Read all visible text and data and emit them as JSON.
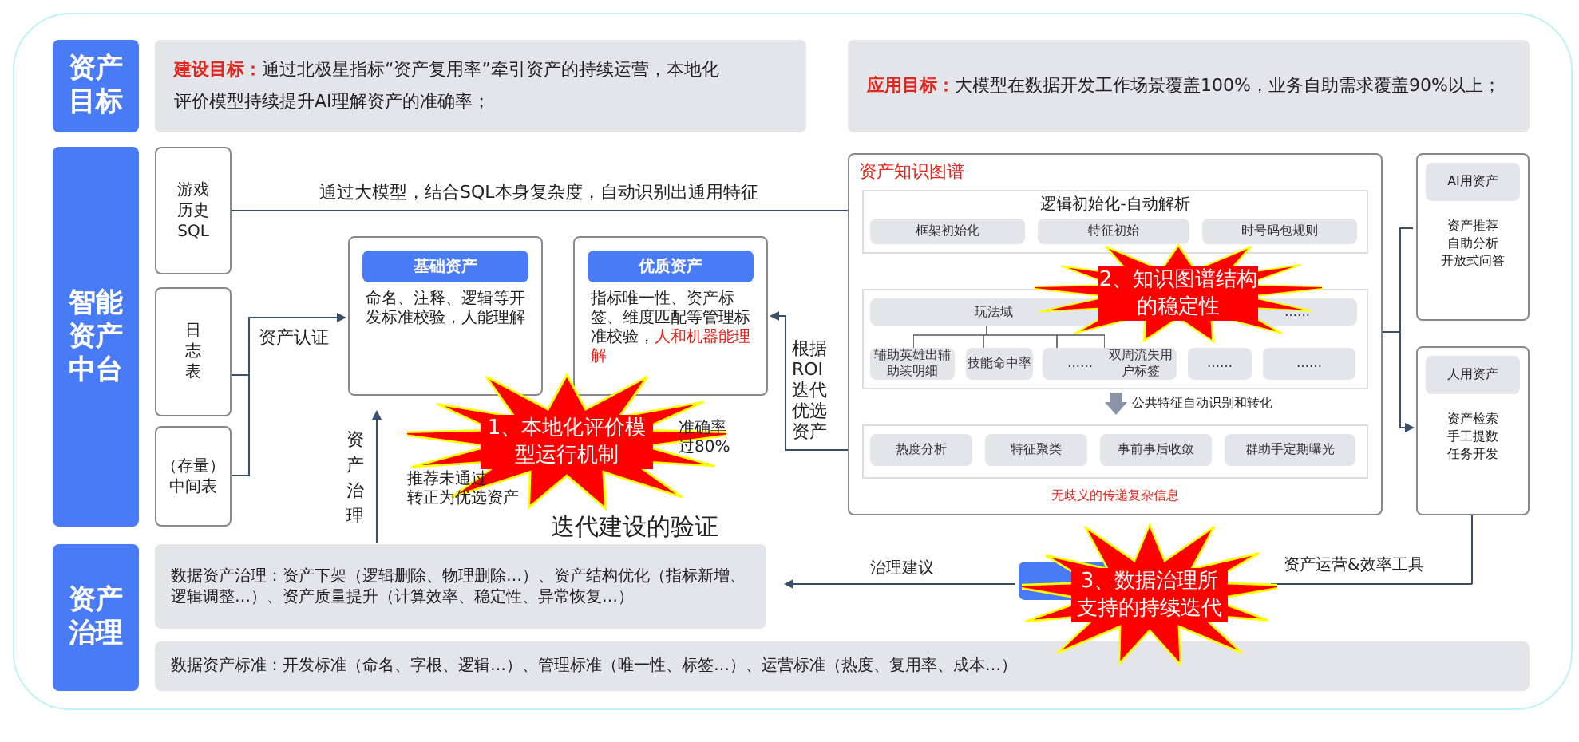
{
  "sections": [
    {
      "title": "资产目标"
    },
    {
      "title": "智能资产中台"
    },
    {
      "title": "资产治理"
    }
  ],
  "goals": [
    {
      "label": "建设目标：",
      "text": "通过北极星指标“资产复用率”牵引资产的持续运营，本地化评价模型持续提升AI理解资产的准确率；"
    },
    {
      "label": "应用目标：",
      "text": "大模型在数据开发工作场景覆盖100%，业务自助需求覆盖90%以上；"
    }
  ],
  "sources": [
    {
      "lines": [
        "游戏",
        "历史",
        "SQL"
      ]
    },
    {
      "lines": [
        "日",
        "志",
        "表"
      ]
    },
    {
      "lines": [
        "（存量）",
        "中间表"
      ]
    }
  ],
  "top_flow": "通过大模型，结合SQL本身复杂度，自动识别出通用特征",
  "certify": "资产认证",
  "asset_cards": [
    {
      "title": "基础资产",
      "text": "命名、注释、逻辑等开发标准校验，人能理解"
    },
    {
      "title": "优质资产",
      "text": "指标唯一性、资产标签、维度匹配等管理标准校验，",
      "highlight": "人和机器能理解"
    }
  ],
  "governance_up": "资产治理",
  "partial_texts": [
    "准确率",
    "过80%",
    "推荐未通过",
    "转正为优选资产"
  ],
  "roi_text": "根据ROI迭代优选资产",
  "validation": "迭代建设的验证",
  "knowledge_graph": {
    "title": "资产知识图谱",
    "init": {
      "title": "逻辑初始化-自动解析",
      "items": [
        "框架初始化",
        "特征初始",
        "时号码包规则"
      ]
    },
    "domains": {
      "headers": [
        "玩法域",
        "……"
      ],
      "items": [
        "辅助英雄出辅助装明细",
        "技能命中率",
        "……",
        "双周流失用户标签",
        "……",
        "……"
      ]
    },
    "transform": "公共特征自动识别和转化",
    "features": [
      "热度分析",
      "特征聚类",
      "事前事后收敛",
      "群助手定期曝光"
    ],
    "footer": "无歧义的传递复杂信息"
  },
  "consumers": [
    {
      "title": "AI用资产",
      "lines": [
        "资产推荐",
        "自助分析",
        "开放式问答"
      ]
    },
    {
      "title": "人用资产",
      "lines": [
        "资产检索",
        "手工提数",
        "任务开发"
      ]
    }
  ],
  "governance_advice": "治理建议",
  "ops_tools": "资产运营&效率工具",
  "governance_rows": [
    "数据资产治理：资产下架（逻辑删除、物理删除…）、资产结构优化（指标新增、逻辑调整…）、资产质量提升（计算效率、稳定性、异常恢复…）",
    "数据资产标准：开发标准（命名、字根、逻辑…）、管理标准（唯一性、标签…）、运营标准（热度、复用率、成本…）"
  ],
  "callouts": [
    "1、本地化评价模型运行机制",
    "2、知识图谱结构的稳定性",
    "3、数据治理所支持的持续迭代"
  ]
}
